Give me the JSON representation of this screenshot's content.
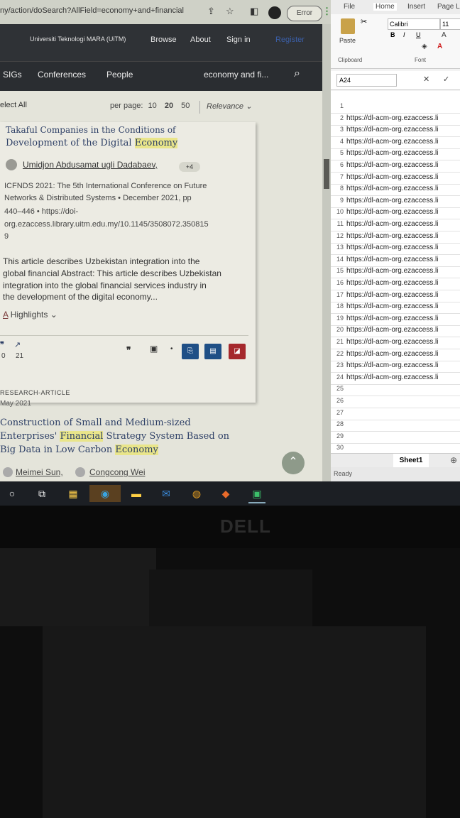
{
  "browser": {
    "url": "ny/action/doSearch?AllField=economy+and+financial",
    "error_label": "Error",
    "header": {
      "institution": "Universiti Teknologi MARA (UiTM)",
      "browse": "Browse",
      "about": "About",
      "signin": "Sign in",
      "register": "Register"
    },
    "nav": {
      "sigs": "SIGs",
      "conferences": "Conferences",
      "people": "People",
      "search_value": "economy and fi..."
    },
    "toolbar": {
      "select_all": "elect All",
      "per_page_label": "per page:",
      "per_page_options": [
        "10",
        "20",
        "50"
      ],
      "sort_label": "Relevance"
    },
    "result1": {
      "title_line1": "Takaful Companies in the Conditions of",
      "title_line2_prefix": "Development of the Digital ",
      "title_line2_highlight": "Economy",
      "author": "Umidjon Abdusamat ugli Dadabaev,",
      "more_authors": "+4",
      "venue_line1": "ICFNDS 2021: The 5th International Conference on Future",
      "venue_line2": "Networks & Distributed Systems • December 2021, pp",
      "venue_line3": "440–446 • https://doi-",
      "venue_line4": "org.ezaccess.library.uitm.edu.my/10.1145/3508072.350815",
      "venue_line5": "9",
      "abstract_line1": "This article describes Uzbekistan integration into the",
      "abstract_line2": "global financial Abstract: This article describes Uzbekistan",
      "abstract_line3": "integration into the global financial services industry in",
      "abstract_line4": "the development of the digital economy...",
      "highlights": "Highlights",
      "citations": "0",
      "downloads": "21"
    },
    "result2": {
      "type": "RESEARCH-ARTICLE",
      "date": "May 2021",
      "title_line1": "Construction of Small and Medium-sized",
      "title_line2_prefix": "Enterprises' ",
      "title_line2_hl1": "Financial",
      "title_line2_mid": " Strategy System Based on",
      "title_line3_prefix": "Big Data in Low Carbon ",
      "title_line3_hl": "Economy",
      "author1": "Meimei Sun,",
      "author2": "Congcong Wei"
    }
  },
  "excel": {
    "tabs": [
      "File",
      "Home",
      "Insert",
      "Page L"
    ],
    "font_name": "Calibri",
    "font_size": "11",
    "paste": "Paste",
    "clipboard": "Clipboard",
    "font_group": "Font",
    "name_box": "A24",
    "rows": [
      "1",
      "2",
      "3",
      "4",
      "5",
      "6",
      "7",
      "8",
      "9",
      "10",
      "11",
      "12",
      "13",
      "14",
      "15",
      "16",
      "17",
      "18",
      "19",
      "20",
      "21",
      "22",
      "23",
      "24",
      "25",
      "26",
      "27",
      "28",
      "29",
      "30"
    ],
    "cells": [
      "",
      "https://dl-acm-org.ezaccess.li",
      "https://dl-acm-org.ezaccess.li",
      "https://dl-acm-org.ezaccess.li",
      "https://dl-acm-org.ezaccess.li",
      "https://dl-acm-org.ezaccess.li",
      "https://dl-acm-org.ezaccess.li",
      "https://dl-acm-org.ezaccess.li",
      "https://dl-acm-org.ezaccess.li",
      "https://dl-acm-org.ezaccess.li",
      "https://dl-acm-org.ezaccess.li",
      "https://dl-acm-org.ezaccess.li",
      "https://dl-acm-org.ezaccess.li",
      "https://dl-acm-org.ezaccess.li",
      "https://dl-acm-org.ezaccess.li",
      "https://dl-acm-org.ezaccess.li",
      "https://dl-acm-org.ezaccess.li",
      "https://dl-acm-org.ezaccess.li",
      "https://dl-acm-org.ezaccess.li",
      "https://dl-acm-org.ezaccess.li",
      "https://dl-acm-org.ezaccess.li",
      "https://dl-acm-org.ezaccess.li",
      "https://dl-acm-org.ezaccess.li",
      "https://dl-acm-org.ezaccess.li",
      "",
      "",
      "",
      "",
      "",
      ""
    ],
    "sheet": "Sheet1",
    "status": "Ready"
  },
  "monitor_brand": "DELL"
}
